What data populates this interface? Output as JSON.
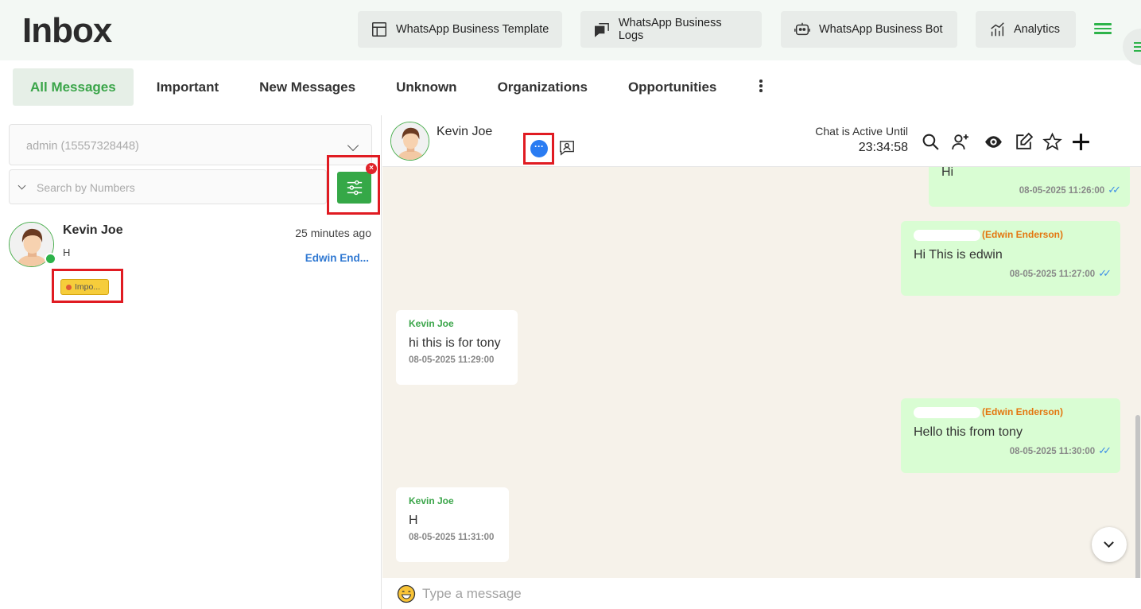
{
  "header": {
    "title": "Inbox",
    "buttons": [
      {
        "label": "WhatsApp Business Template",
        "icon": "template-icon"
      },
      {
        "label": "WhatsApp Business Logs",
        "icon": "logs-icon"
      },
      {
        "label": "WhatsApp Business Bot",
        "icon": "bot-icon"
      },
      {
        "label": "Analytics",
        "icon": "analytics-icon"
      }
    ]
  },
  "tabs": [
    "All Messages",
    "Important",
    "New Messages",
    "Unknown",
    "Organizations",
    "Opportunities"
  ],
  "active_tab": "All Messages",
  "left": {
    "account_select": "admin (15557328448)",
    "search_placeholder": "Search by Numbers",
    "filter_badge": "×",
    "contact": {
      "name": "Kevin Joe",
      "time": "25 minutes ago",
      "last_message": "H",
      "agent": "Edwin End...",
      "tag": "Impo..."
    }
  },
  "chat": {
    "name": "Kevin Joe",
    "active_label": "Chat is Active Until",
    "active_time": "23:34:58",
    "messages": [
      {
        "dir": "out",
        "sender": "",
        "text": "Hi",
        "time": "08-05-2025 11:26:00"
      },
      {
        "dir": "out",
        "sender": "(Edwin Enderson)",
        "text": "Hi This is edwin",
        "time": "08-05-2025 11:27:00"
      },
      {
        "dir": "in",
        "sender": "Kevin Joe",
        "text": "hi this is for tony",
        "time": "08-05-2025 11:29:00"
      },
      {
        "dir": "out",
        "sender": "(Edwin Enderson)",
        "text": "Hello this from tony",
        "time": "08-05-2025 11:30:00"
      },
      {
        "dir": "in",
        "sender": "Kevin Joe",
        "text": "H",
        "time": "08-05-2025 11:31:00"
      }
    ],
    "composer_placeholder": "Type a message"
  },
  "colors": {
    "accent": "#35a847",
    "highlight": "#e01b22",
    "outgoing_bubble": "#d9fdd3",
    "chat_bg": "#f6f2ea"
  }
}
